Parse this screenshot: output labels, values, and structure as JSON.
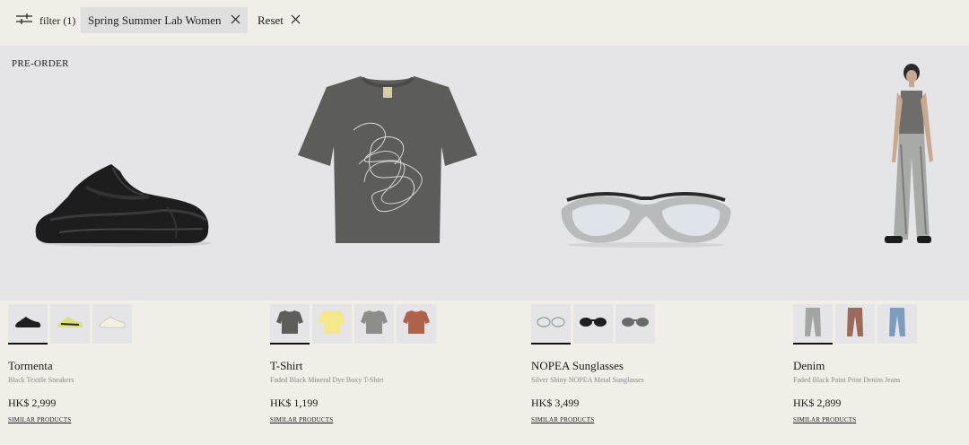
{
  "filterbar": {
    "filter_label": "filter (1)",
    "active_filter": "Spring Summer Lab Women",
    "reset_label": "Reset"
  },
  "band": {
    "badge": "PRE-ORDER"
  },
  "products": [
    {
      "name": "Tormenta",
      "description": "Black Textile Sneakers",
      "price": "HK$ 2,999",
      "similar": "SIMILAR PRODUCTS",
      "swatch_icons": [
        "sneaker-black-icon",
        "sneaker-lime-icon",
        "sneaker-white-icon"
      ]
    },
    {
      "name": "T-Shirt",
      "description": "Faded Black Mineral Dye Boxy T-Shirt",
      "price": "HK$ 1,199",
      "similar": "SIMILAR PRODUCTS",
      "swatch_icons": [
        "tshirt-grey-icon",
        "tshirt-yellow-icon",
        "tshirt-lightgrey-icon",
        "tshirt-rust-icon"
      ]
    },
    {
      "name": "NOPEA Sunglasses",
      "description": "Silver Shiny NOPEA Metal Sunglasses",
      "price": "HK$ 3,499",
      "similar": "SIMILAR PRODUCTS",
      "swatch_icons": [
        "sunglasses-silver-icon",
        "sunglasses-black-icon",
        "sunglasses-grey-icon"
      ]
    },
    {
      "name": "Denim",
      "description": "Faded Black Paint Print Denim Jeans",
      "price": "HK$ 2,899",
      "similar": "SIMILAR PRODUCTS",
      "swatch_icons": [
        "jeans-grey-icon",
        "jeans-brown-icon",
        "jeans-blue-icon"
      ]
    }
  ],
  "colors": {
    "background": "#f1eee7",
    "image_band": "#e5e5e7",
    "chip": "#dfdfdf",
    "description_text": "#8a8a8a"
  }
}
